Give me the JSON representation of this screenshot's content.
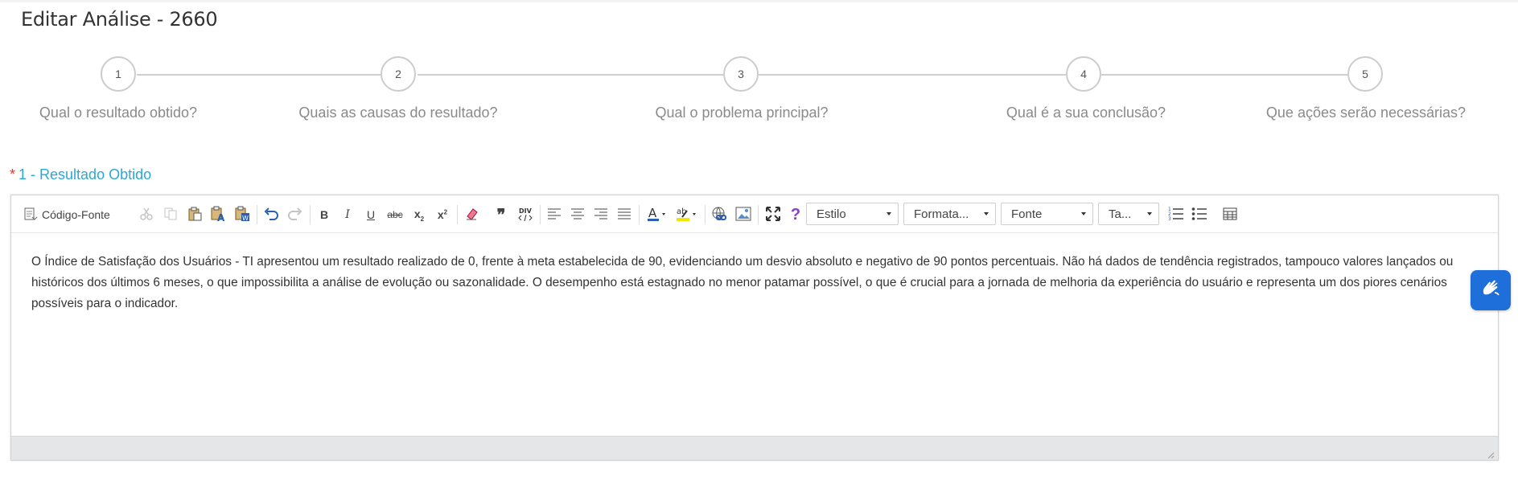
{
  "page": {
    "title": "Editar Análise - 2660"
  },
  "steps": [
    {
      "number": "1",
      "label": "Qual o resultado obtido?"
    },
    {
      "number": "2",
      "label": "Quais as causas do resultado?"
    },
    {
      "number": "3",
      "label": "Qual o problema principal?"
    },
    {
      "number": "4",
      "label": "Qual é a sua conclusão?"
    },
    {
      "number": "5",
      "label": "Que ações serão necessárias?"
    }
  ],
  "field": {
    "required_mark": "*",
    "label": "1 - Resultado Obtido"
  },
  "toolbar": {
    "source_label": "Código-Fonte",
    "combos": {
      "style": "Estilo",
      "format": "Formata...",
      "font": "Fonte",
      "size": "Ta..."
    }
  },
  "editor": {
    "content": "O Índice de Satisfação dos Usuários - TI apresentou um resultado realizado de 0, frente à meta estabelecida de 90, evidenciando um desvio absoluto e negativo de 90 pontos percentuais. Não há dados de tendência registrados, tampouco valores lançados ou históricos dos últimos 6 meses, o que impossibilita a análise de evolução ou sazonalidade. O desempenho está estagnado no menor patamar possível, o que é crucial para a jornada de melhoria da experiência do usuário e representa um dos piores cenários possíveis para o indicador."
  },
  "colors": {
    "accent": "#29a8d8",
    "required": "#e53935",
    "a11y": "#1e6fd9"
  },
  "icons": [
    "source-icon",
    "cut-icon",
    "copy-icon",
    "paste-icon",
    "paste-text-icon",
    "paste-word-icon",
    "undo-icon",
    "redo-icon",
    "bold-icon",
    "italic-icon",
    "underline-icon",
    "strike-icon",
    "subscript-icon",
    "superscript-icon",
    "remove-format-icon",
    "blockquote-icon",
    "div-icon",
    "align-left-icon",
    "align-center-icon",
    "align-right-icon",
    "justify-icon",
    "text-color-icon",
    "bg-color-icon",
    "link-icon",
    "image-icon",
    "maximize-icon",
    "help-icon",
    "numbered-list-icon",
    "bulleted-list-icon",
    "table-icon",
    "sign-language-icon"
  ]
}
